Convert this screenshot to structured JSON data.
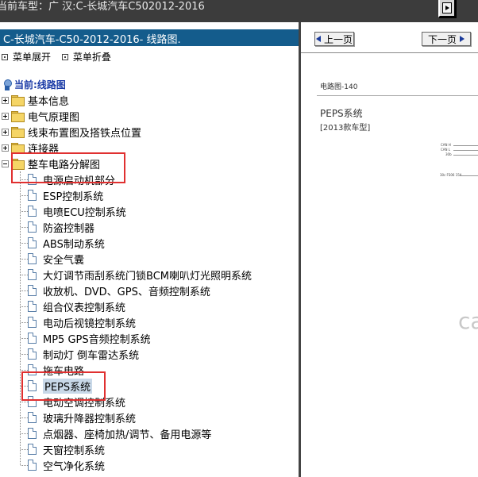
{
  "window": {
    "title": "当前车型：广 汉:C-长城汽车C502012-2016"
  },
  "left_panel": {
    "header": "C-长城汽车-C50-2012-2016- 线路图.",
    "menu_expand": "菜单展开",
    "menu_collapse": "菜单折叠",
    "current_label": "当前:线路图",
    "folders": [
      {
        "label": "基本信息"
      },
      {
        "label": "电气原理图"
      },
      {
        "label": "线束布置图及搭铁点位置"
      },
      {
        "label": "连接器"
      },
      {
        "label": "整车电路分解图"
      }
    ],
    "leaves": [
      {
        "label": "电源启动机部分"
      },
      {
        "label": "ESP控制系统"
      },
      {
        "label": "电喷ECU控制系统"
      },
      {
        "label": "防盗控制器"
      },
      {
        "label": "ABS制动系统"
      },
      {
        "label": "安全气囊"
      },
      {
        "label": "大灯调节雨刮系统门锁BCM喇叭灯光照明系统"
      },
      {
        "label": "收放机、DVD、GPS、音频控制系统"
      },
      {
        "label": "组合仪表控制系统"
      },
      {
        "label": "电动后视镜控制系统"
      },
      {
        "label": "MP5 GPS音频控制系统"
      },
      {
        "label": "制动灯 倒车雷达系统"
      },
      {
        "label": "拖车电路"
      },
      {
        "label": "PEPS系统"
      },
      {
        "label": "电动空调控制系统"
      },
      {
        "label": "玻璃升降器控制系统"
      },
      {
        "label": "点烟器、座椅加热/调节、备用电源等"
      },
      {
        "label": "天窗控制系统"
      },
      {
        "label": "空气净化系统"
      }
    ],
    "selected_leaf": "PEPS系统"
  },
  "right_panel": {
    "prev_button": "上一页",
    "next_button": "下一页",
    "page_number": "电路图-140",
    "doc_title": "PEPS系统",
    "doc_subtitle": "[2013款车型]",
    "tiny_labels": [
      "CAN H",
      "CAN L",
      "30b",
      "30c FS06 15A"
    ],
    "watermark": "ca"
  },
  "colors": {
    "header_bg": "#145c8c",
    "top_bar_bg": "#3c3c3c",
    "highlight_box": "#e03030",
    "current_label": "#1a3aa6"
  }
}
